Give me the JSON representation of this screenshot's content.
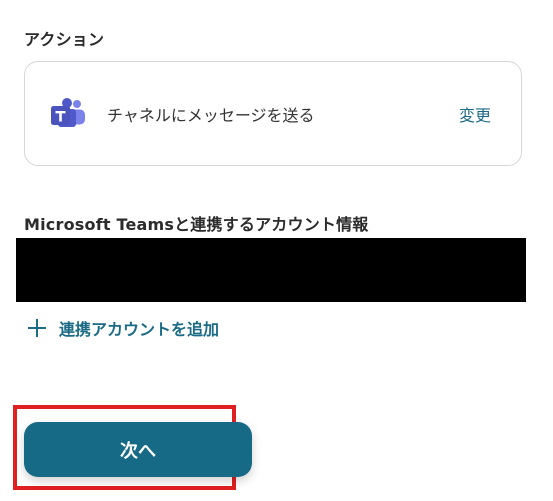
{
  "action_section": {
    "label": "アクション",
    "card": {
      "icon": "microsoft-teams-icon",
      "action_name": "チャネルにメッセージを送る",
      "change_label": "変更"
    }
  },
  "account_section": {
    "label": "Microsoft Teamsと連携するアカウント情報",
    "add_account_label": "連携アカウントを追加"
  },
  "footer": {
    "next_label": "次へ"
  },
  "colors": {
    "accent": "#1b6a86",
    "button": "#166a85",
    "highlight": "#e02020",
    "teams_purple": "#5b5fc7"
  }
}
